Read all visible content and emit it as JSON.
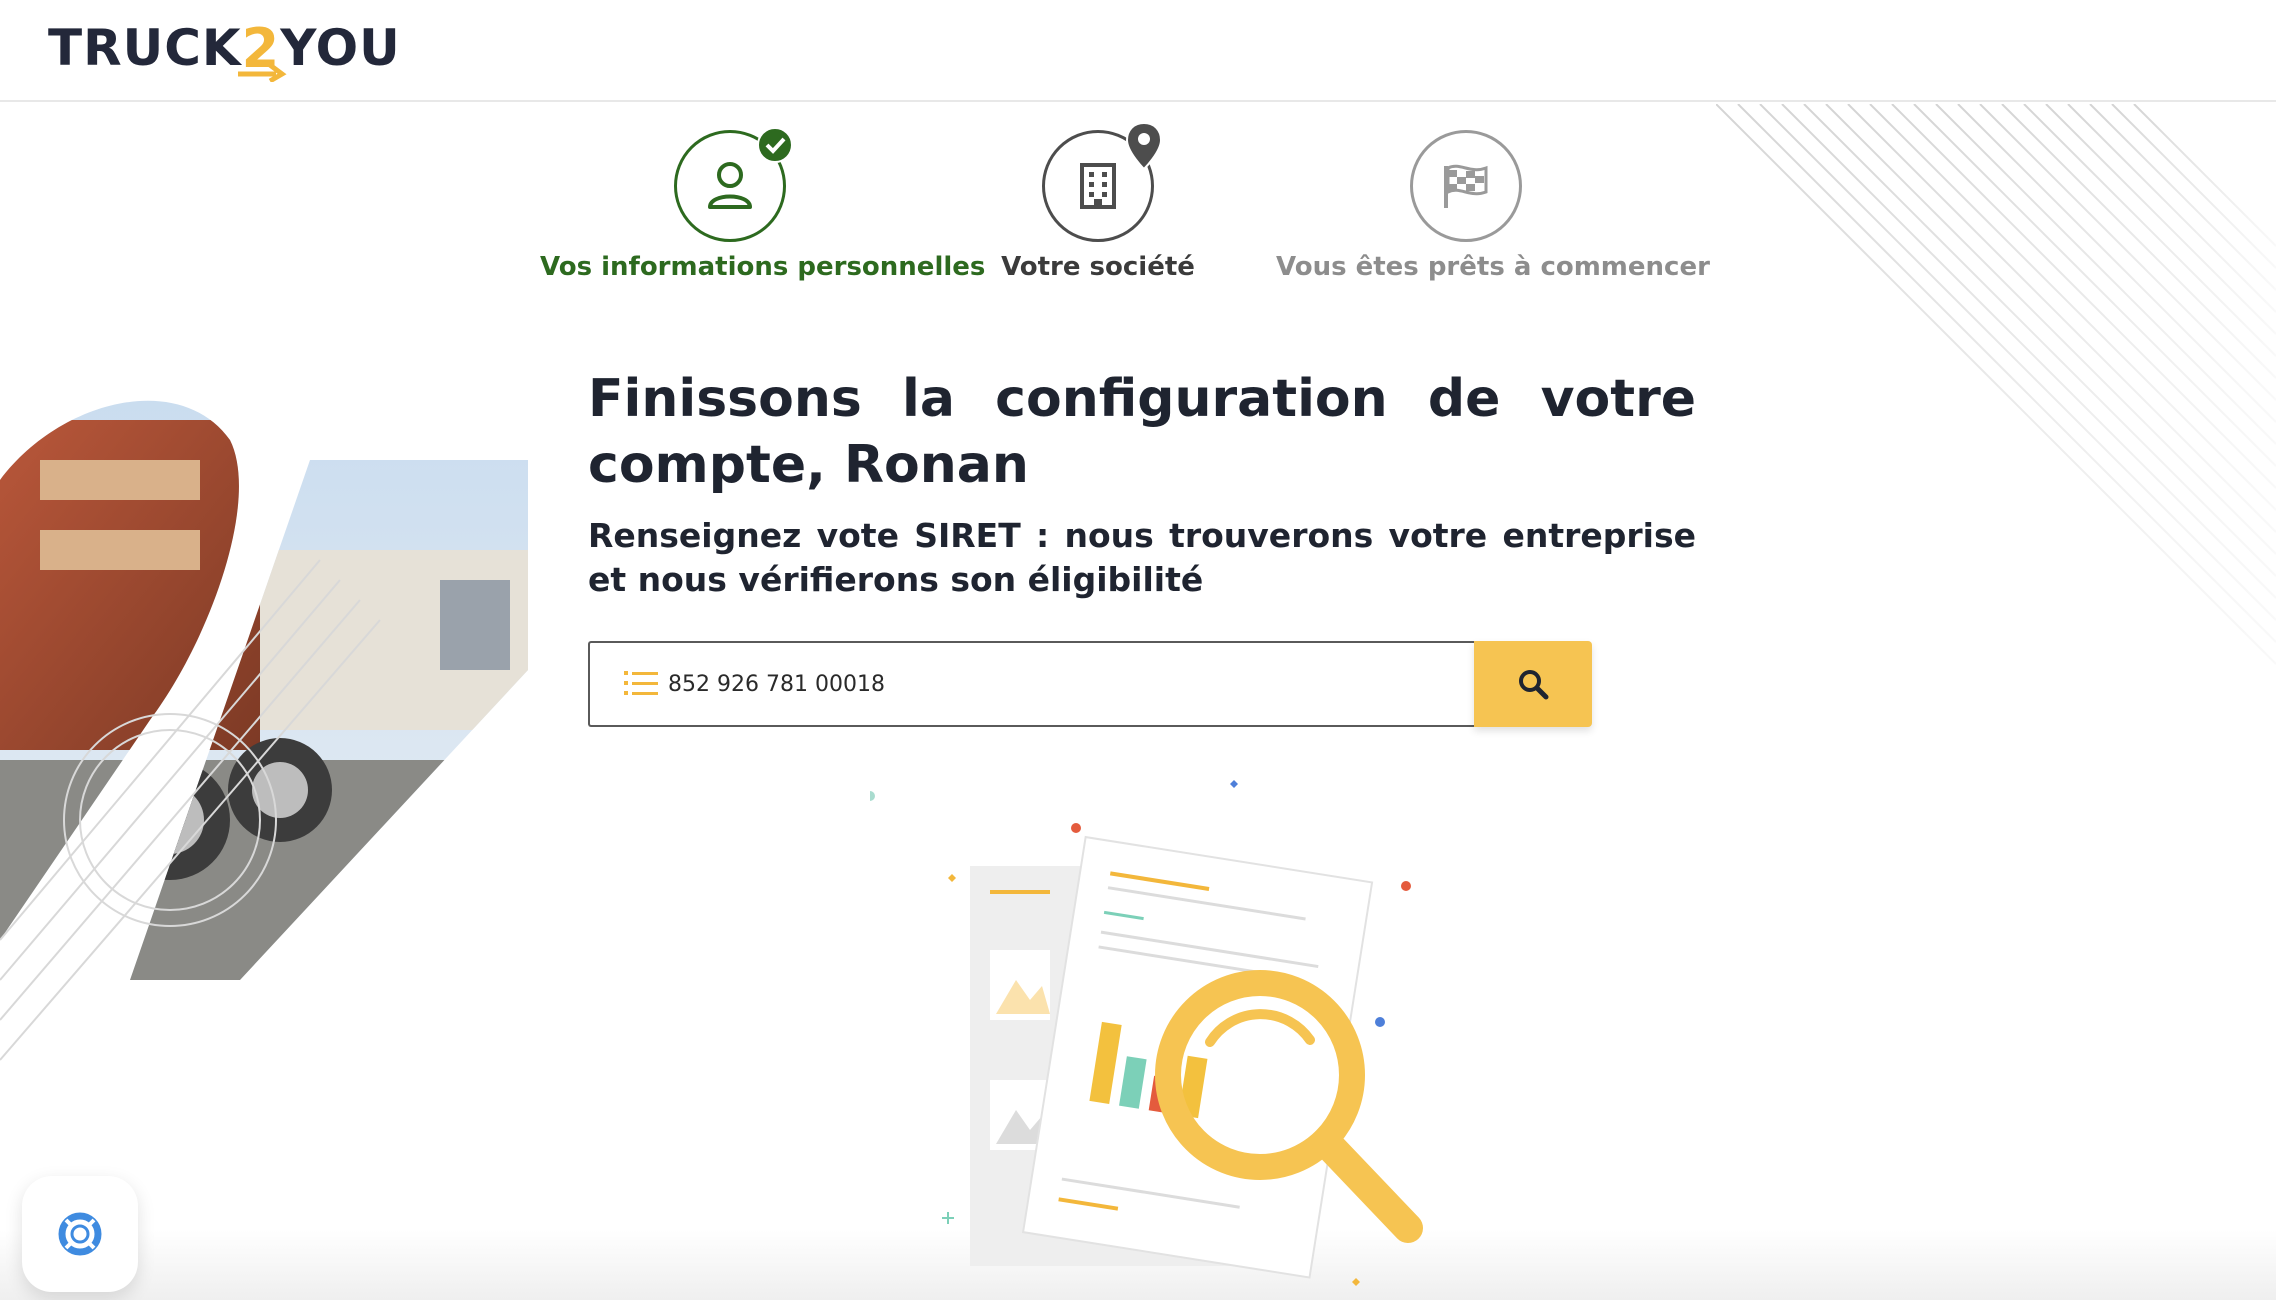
{
  "brand": {
    "name_part1": "TRUCK",
    "name_num": "2",
    "name_part2": "YOU",
    "accent_color": "#f3b73b",
    "dark_color": "#23283a"
  },
  "stepper": {
    "steps": [
      {
        "label": "Vos informations personnelles",
        "icon": "user-icon",
        "status": "completed",
        "badge_icon": "check-icon",
        "color": "#2d6a1f"
      },
      {
        "label": "Votre société",
        "icon": "building-icon",
        "status": "current",
        "badge_icon": "location-pin-icon",
        "color": "#4d4d4d"
      },
      {
        "label": "Vous êtes prêts à commencer",
        "icon": "checkered-flag-icon",
        "status": "upcoming",
        "color": "#9a9a9a"
      }
    ]
  },
  "main": {
    "title": "Finissons la configuration de votre compte, Ronan",
    "subtitle": "Renseignez vote SIRET : nous trouverons votre entreprise et nous vérifierons son éligibilité",
    "search": {
      "value": "852 926 781 00018",
      "icon": "numbered-list-icon",
      "button_icon": "search-icon",
      "button_color": "#f6c452"
    }
  },
  "help": {
    "icon": "lifebuoy-icon"
  }
}
